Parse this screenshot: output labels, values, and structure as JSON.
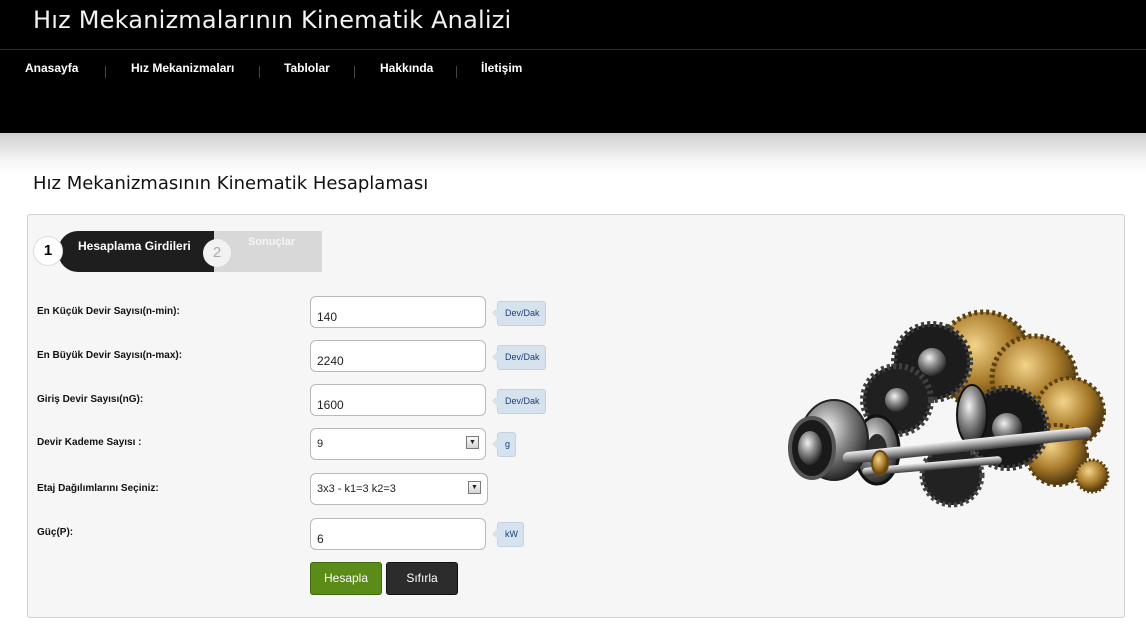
{
  "site": {
    "title": "Hız Mekanizmalarının Kinematik Analizi"
  },
  "nav": {
    "items": [
      {
        "label": "Anasayfa"
      },
      {
        "label": "Hız Mekanizmaları"
      },
      {
        "label": "Tablolar"
      },
      {
        "label": "Hakkında"
      },
      {
        "label": "İletişim"
      }
    ]
  },
  "page": {
    "heading": "Hız Mekanizmasının Kinematik Hesaplaması"
  },
  "wizard": {
    "step1": {
      "number": "1",
      "label": "Hesaplama Girdileri",
      "active": true
    },
    "step2": {
      "number": "2",
      "label": "Sonuçlar",
      "active": false
    }
  },
  "form": {
    "n_min": {
      "label": "En Küçük Devir Sayısı(n-min):",
      "value": "140",
      "unit": "Dev/Dak"
    },
    "n_max": {
      "label": "En Büyük Devir Sayısı(n-max):",
      "value": "2240",
      "unit": "Dev/Dak"
    },
    "n_g": {
      "label": "Giriş Devir Sayısı(nG):",
      "value": "1600",
      "unit": "Dev/Dak"
    },
    "stages": {
      "label": "Devir Kademe Sayısı :",
      "value": "9",
      "unit": "g"
    },
    "distribution": {
      "label": "Etaj Dağılımlarını Seçiniz:",
      "value": "3x3 - k1=3 k2=3"
    },
    "power": {
      "label": "Güç(P):",
      "value": "6",
      "unit": "kW"
    }
  },
  "buttons": {
    "calculate": "Hesapla",
    "reset": "Sıfırla"
  },
  "colors": {
    "header_bg": "#000000",
    "calculate_button": "#5b8b18",
    "reset_button": "#2c2c2c",
    "unit_badge": "#d6e2ee"
  },
  "image": {
    "subject": "gearbox-illustration"
  }
}
